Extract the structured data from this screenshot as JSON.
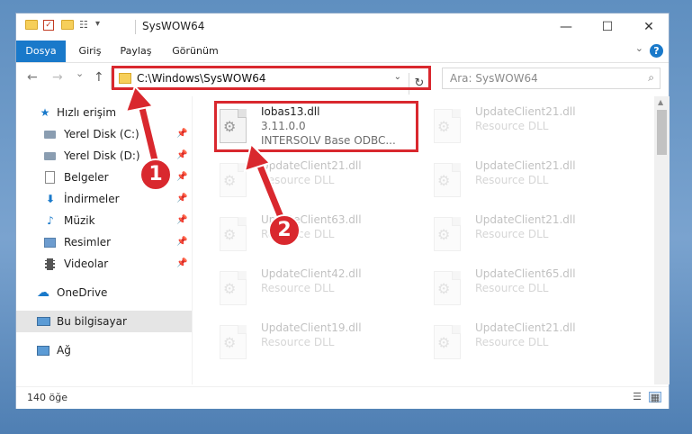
{
  "window": {
    "title": "SysWOW64",
    "quick_access_toolbar": [
      "folder-icon",
      "properties-icon",
      "new-folder-icon",
      "customize-icon"
    ],
    "minimize": "—",
    "maximize": "☐",
    "close": "✕"
  },
  "ribbon": {
    "tabs": [
      {
        "label": "Dosya",
        "active": true
      },
      {
        "label": "Giriş",
        "active": false
      },
      {
        "label": "Paylaş",
        "active": false
      },
      {
        "label": "Görünüm",
        "active": false
      }
    ],
    "help": "?"
  },
  "address": {
    "back": "←",
    "forward": "→",
    "recent": "⌄",
    "up": "↑",
    "path": "C:\\Windows\\SysWOW64",
    "refresh": "↻",
    "search_placeholder": "Ara: SysWOW64"
  },
  "nav": {
    "items": [
      {
        "label": "Hızlı erişim",
        "icon": "star-icon",
        "pinned": false
      },
      {
        "label": "Yerel Disk (C:)",
        "icon": "drive-icon",
        "pinned": true
      },
      {
        "label": "Yerel Disk (D:)",
        "icon": "drive-icon",
        "pinned": true
      },
      {
        "label": "Belgeler",
        "icon": "documents-icon",
        "pinned": true
      },
      {
        "label": "İndirmeler",
        "icon": "download-icon",
        "pinned": true
      },
      {
        "label": "Müzik",
        "icon": "music-icon",
        "pinned": true
      },
      {
        "label": "Resimler",
        "icon": "pictures-icon",
        "pinned": true
      },
      {
        "label": "Videolar",
        "icon": "videos-icon",
        "pinned": true
      },
      {
        "label": "OneDrive",
        "icon": "cloud-icon",
        "pinned": false
      },
      {
        "label": "Bu bilgisayar",
        "icon": "computer-icon",
        "pinned": false,
        "selected": true
      },
      {
        "label": "Ağ",
        "icon": "network-icon",
        "pinned": false
      }
    ]
  },
  "files": [
    {
      "name": "Iobas13.dll",
      "version": "3.11.0.0",
      "description": "INTERSOLV Base ODBC...",
      "highlighted": true
    },
    {
      "name": "UpdateClient21.dll",
      "description": "Resource DLL"
    },
    {
      "name": "UpdateClient21.dll",
      "description": "Resource DLL"
    },
    {
      "name": "UpdateClient21.dll",
      "description": "Resource DLL"
    },
    {
      "name": "UpdateClient63.dll",
      "description": "Resource DLL"
    },
    {
      "name": "UpdateClient21.dll",
      "description": "Resource DLL"
    },
    {
      "name": "UpdateClient42.dll",
      "description": "Resource DLL"
    },
    {
      "name": "UpdateClient65.dll",
      "description": "Resource DLL"
    },
    {
      "name": "UpdateClient19.dll",
      "description": "Resource DLL"
    },
    {
      "name": "UpdateClient21.dll",
      "description": "Resource DLL"
    }
  ],
  "status": {
    "count": "140 öğe"
  },
  "callouts": [
    "1",
    "2"
  ],
  "colors": {
    "accent": "#1979ca",
    "highlight": "#d9282e"
  }
}
